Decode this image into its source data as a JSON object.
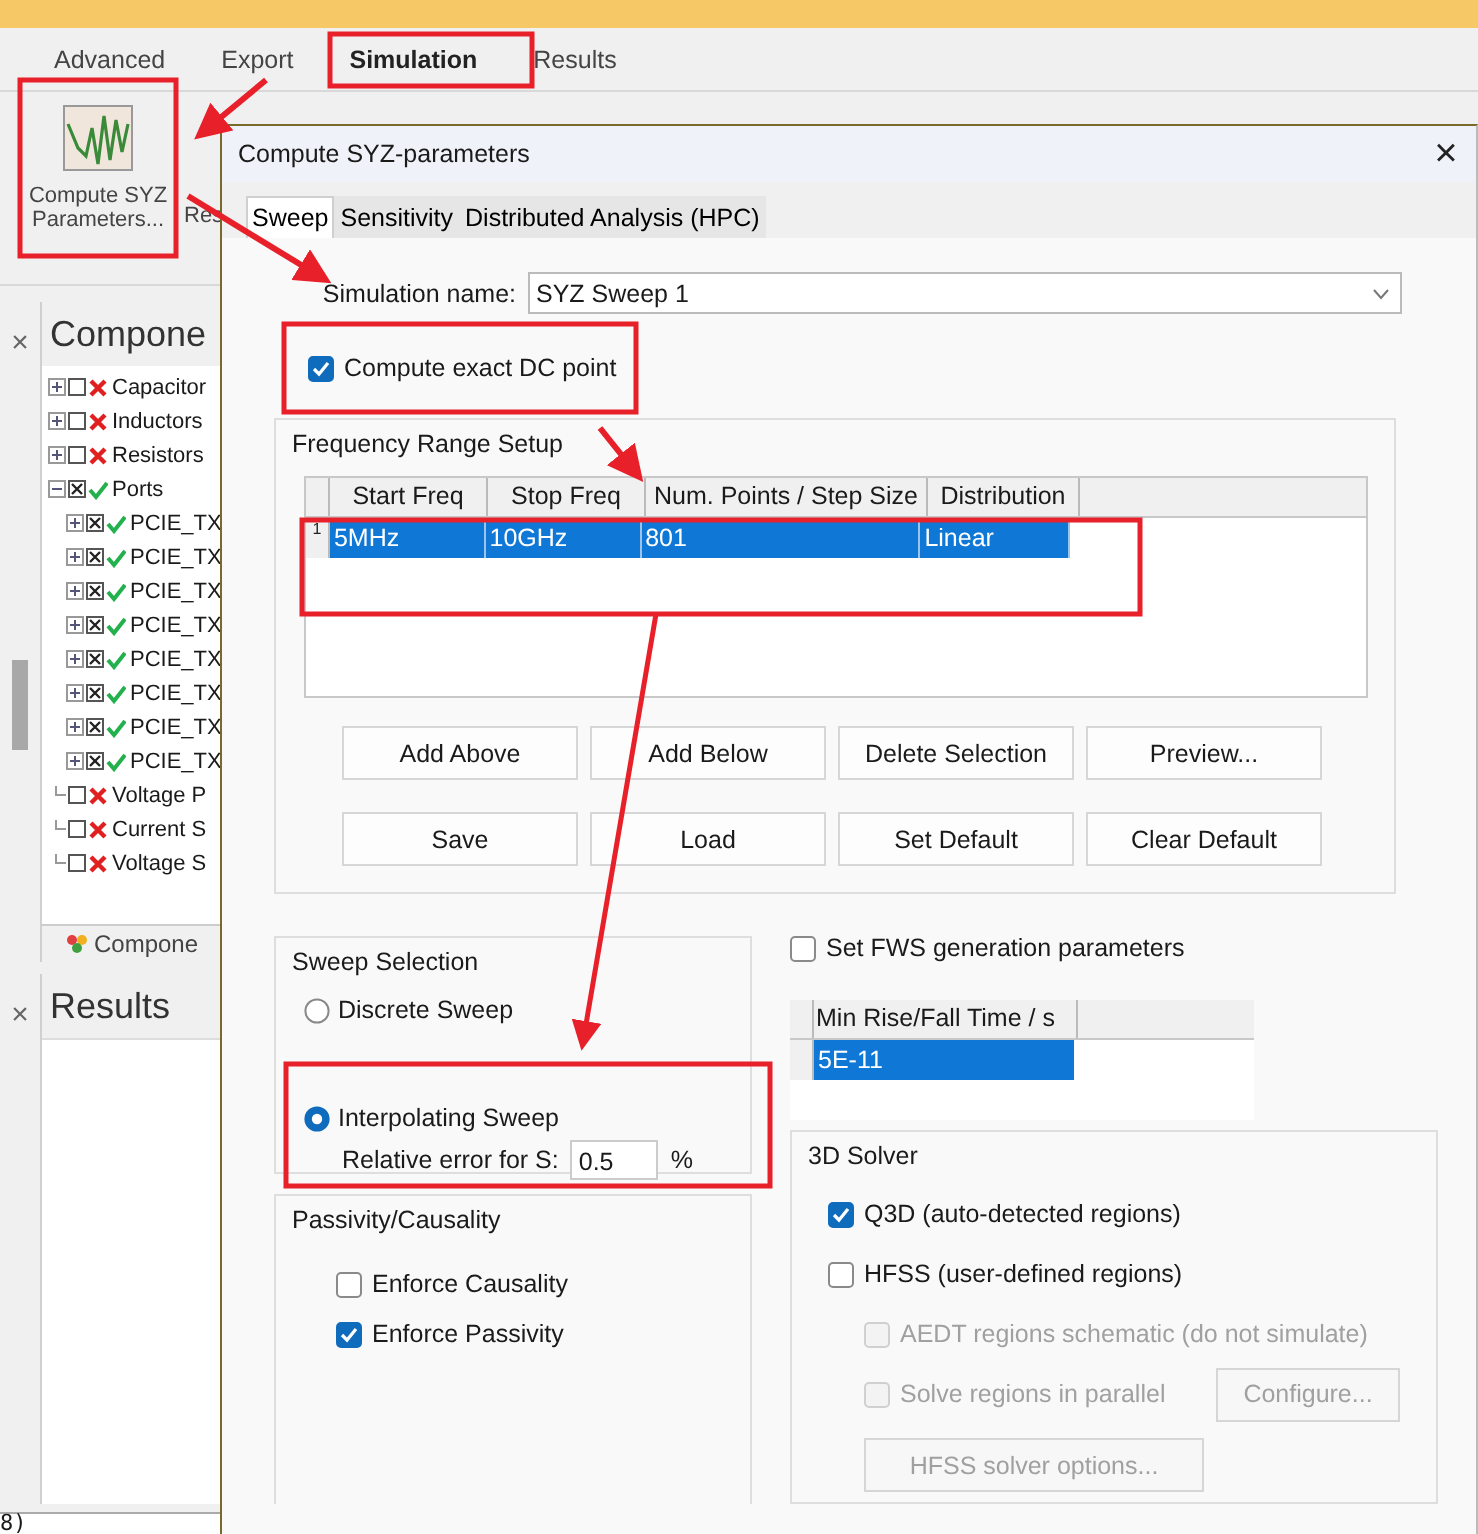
{
  "ribbon_tabs": [
    {
      "label": "Advanced",
      "selected": false
    },
    {
      "label": "Export",
      "selected": false
    },
    {
      "label": "Simulation",
      "selected": true
    },
    {
      "label": "Results",
      "selected": false
    }
  ],
  "toolbar": {
    "compute_button": "Compute SYZ Parameters...",
    "next_button": "Res"
  },
  "components_panel": {
    "close": "×",
    "title": "Compone",
    "tab": "Compone",
    "tree": [
      {
        "label": "Capacitor",
        "checked": false,
        "valid": false,
        "expanded": false
      },
      {
        "label": "Inductors",
        "checked": false,
        "valid": false,
        "expanded": false
      },
      {
        "label": "Resistors",
        "checked": false,
        "valid": false,
        "expanded": false
      },
      {
        "label": "Ports",
        "checked": true,
        "valid": true,
        "expanded": true,
        "children": [
          {
            "label": "PCIE_TX",
            "checked": true,
            "valid": true,
            "expanded": false
          },
          {
            "label": "PCIE_TX",
            "checked": true,
            "valid": true,
            "expanded": false
          },
          {
            "label": "PCIE_TX",
            "checked": true,
            "valid": true,
            "expanded": false
          },
          {
            "label": "PCIE_TX",
            "checked": true,
            "valid": true,
            "expanded": false
          },
          {
            "label": "PCIE_TX",
            "checked": true,
            "valid": true,
            "expanded": false
          },
          {
            "label": "PCIE_TX",
            "checked": true,
            "valid": true,
            "expanded": false
          },
          {
            "label": "PCIE_TX",
            "checked": true,
            "valid": true,
            "expanded": false
          },
          {
            "label": "PCIE_TX",
            "checked": true,
            "valid": true,
            "expanded": false
          }
        ]
      },
      {
        "label": "Voltage P",
        "checked": false,
        "valid": false
      },
      {
        "label": "Current S",
        "checked": false,
        "valid": false
      },
      {
        "label": "Voltage S",
        "checked": false,
        "valid": false
      }
    ]
  },
  "results_panel": {
    "close": "×",
    "title": "Results"
  },
  "status_text": "8)",
  "dialog": {
    "title": "Compute SYZ-parameters",
    "close": "×",
    "tabs": [
      {
        "label": "Sweep",
        "selected": true
      },
      {
        "label": "Sensitivity",
        "selected": false
      },
      {
        "label": "Distributed Analysis (HPC)",
        "selected": false
      }
    ],
    "simulation_name": {
      "label": "Simulation name:",
      "value": "SYZ Sweep 1"
    },
    "exact_dc": {
      "label": "Compute exact DC point",
      "checked": true
    },
    "frequency_range": {
      "title": "Frequency Range Setup",
      "columns": [
        "Start Freq",
        "Stop Freq",
        "Num. Points / Step Size",
        "Distribution"
      ],
      "rows": [
        {
          "index": "1",
          "cells": [
            "5MHz",
            "10GHz",
            "801",
            "Linear"
          ],
          "selected": true
        }
      ],
      "buttons": [
        "Add Above",
        "Add Below",
        "Delete Selection",
        "Preview...",
        "Save",
        "Load",
        "Set Default",
        "Clear Default"
      ]
    },
    "sweep_selection": {
      "title": "Sweep Selection",
      "options": [
        {
          "label": "Discrete Sweep",
          "selected": false
        },
        {
          "label": "Interpolating Sweep",
          "selected": true
        }
      ],
      "relative_error": {
        "label": "Relative error for S:",
        "value": "0.5",
        "unit": "%"
      }
    },
    "passivity": {
      "title": "Passivity/Causality",
      "options": [
        {
          "label": "Enforce Causality",
          "checked": false
        },
        {
          "label": "Enforce Passivity",
          "checked": true
        }
      ]
    },
    "fws": {
      "label": "Set FWS generation parameters",
      "checked": false,
      "column": "Min Rise/Fall Time / s",
      "rows": [
        {
          "value": "5E-11",
          "selected": true
        }
      ]
    },
    "solver": {
      "title": "3D Solver",
      "options": [
        {
          "label": "Q3D (auto-detected regions)",
          "checked": true,
          "disabled": false
        },
        {
          "label": "HFSS (user-defined regions)",
          "checked": false,
          "disabled": false
        },
        {
          "label": "AEDT regions schematic (do not simulate)",
          "checked": false,
          "disabled": true
        },
        {
          "label": "Solve regions in parallel",
          "checked": false,
          "disabled": true
        }
      ],
      "configure_button": {
        "label": "Configure...",
        "disabled": true
      },
      "options_button": {
        "label": "HFSS solver options...",
        "disabled": true
      }
    }
  }
}
